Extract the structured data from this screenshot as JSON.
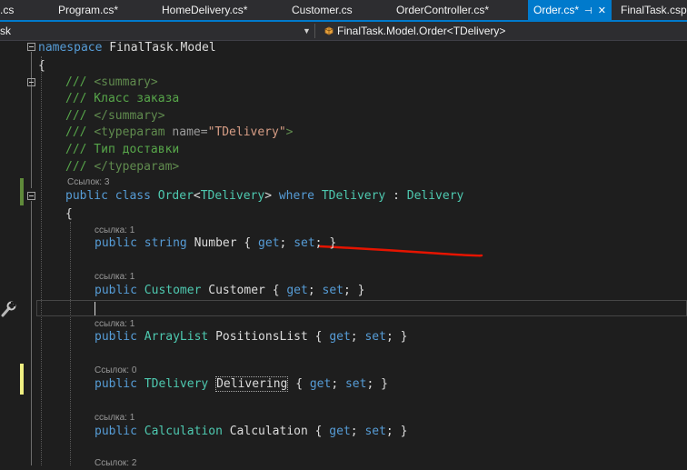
{
  "tabs": [
    {
      "label": ".cs"
    },
    {
      "label": "Program.cs*"
    },
    {
      "label": "HomeDelivery.cs*"
    },
    {
      "label": "Customer.cs"
    },
    {
      "label": "OrderController.cs*"
    },
    {
      "label": "Order.cs*",
      "active": true
    },
    {
      "label": "FinalTask.cspro"
    }
  ],
  "nav": {
    "project": "sk",
    "member": "FinalTask.Model.Order<TDelivery>"
  },
  "code": {
    "l1": {
      "kw": "namespace",
      "rest": " FinalTask.Model"
    },
    "l2": {
      "text": "{"
    },
    "l3": {
      "prefix": "/// ",
      "tag": "<summary>"
    },
    "l4": {
      "text": "/// Класс заказа"
    },
    "l5": {
      "prefix": "/// ",
      "tag": "</summary>"
    },
    "l6": {
      "prefix": "/// ",
      "tag_open": "<typeparam",
      "attr": " name=",
      "value": "\"TDelivery\"",
      "tag_close": ">"
    },
    "l7": {
      "text": "/// Тип доставки"
    },
    "l8": {
      "prefix": "/// ",
      "tag": "</typeparam>"
    },
    "lens_class": "Ссылок: 3",
    "l9": {
      "kw1": "public",
      "kw2": "class",
      "type1": "Order",
      "lt": "<",
      "type2": "TDelivery",
      "gt": ">",
      "kw3": "where",
      "type3": "TDelivery",
      "colon": " : ",
      "type4": "Delivery"
    },
    "l10": {
      "text": "{"
    },
    "lens1": "ссылка: 1",
    "p1": {
      "kw": "public",
      "type": "string",
      "name": "Number",
      "ob": "{ ",
      "get": "get",
      "semi1": "; ",
      "set": "set",
      "cb": "; }"
    },
    "lens2": "ссылка: 1",
    "p2": {
      "kw": "public",
      "type": "Customer",
      "name": "Customer",
      "ob": "{ ",
      "get": "get",
      "semi1": "; ",
      "set": "set",
      "cb": "; }"
    },
    "lens3": "ссылка: 1",
    "p3": {
      "kw": "public",
      "type": "ArrayList",
      "name": "PositionsList",
      "ob": "{ ",
      "get": "get",
      "semi1": "; ",
      "set": "set",
      "cb": "; }"
    },
    "lens4": "Ссылок: 0",
    "p4": {
      "kw": "public",
      "type": "TDelivery",
      "name": "Delivering",
      "ob": "{ ",
      "get": "get",
      "semi1": "; ",
      "set": "set",
      "cb": "; }"
    },
    "lens5": "ссылка: 1",
    "p5": {
      "kw": "public",
      "type": "Calculation",
      "name": "Calculation",
      "ob": "{ ",
      "get": "get",
      "semi1": "; ",
      "set": "set",
      "cb": "; }"
    },
    "lens6": "Ссылок: 2"
  },
  "colors": {
    "keyword": "#569cd6",
    "type": "#4ec9b0",
    "comment": "#57a64a",
    "accent": "#007acc",
    "annotation": "#e51400"
  },
  "icons": [
    "class-icon",
    "fold-toggle-icon",
    "wrench-icon",
    "pin-icon",
    "close-icon",
    "dropdown-arrow-icon"
  ]
}
